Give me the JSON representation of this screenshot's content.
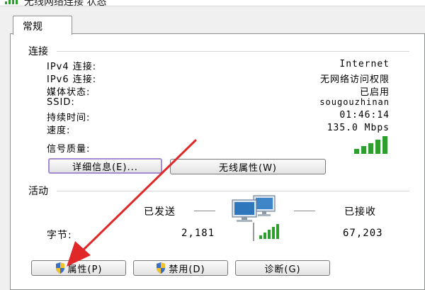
{
  "window": {
    "title": "无线网络连接 状态"
  },
  "tabs": [
    {
      "label": "常规"
    }
  ],
  "connection": {
    "section_label": "连接",
    "rows": [
      {
        "key": "IPv4 连接:",
        "value": "Internet"
      },
      {
        "key": "IPv6 连接:",
        "value": "无网络访问权限"
      },
      {
        "key": "媒体状态:",
        "value": "已启用"
      },
      {
        "key": "SSID:",
        "value": "sougouzhinan"
      },
      {
        "key": "持续时间:",
        "value": "01:46:14"
      },
      {
        "key": "速度:",
        "value": "135.0 Mbps"
      }
    ],
    "signal_label": "信号质量:",
    "signal_bars": 5,
    "buttons": {
      "details": "详细信息(E)...",
      "wireless_props": "无线属性(W)"
    }
  },
  "activity": {
    "section_label": "活动",
    "sent_label": "已发送",
    "received_label": "已接收",
    "bytes_label": "字节:",
    "bytes_sent": "2,181",
    "bytes_received": "67,203"
  },
  "bottom_buttons": {
    "properties": "属性(P)",
    "disable": "禁用(D)",
    "diagnose": "诊断(G)"
  },
  "icons": [
    "wireless-signal-icon",
    "network-computers-icon",
    "uac-shield-icon"
  ],
  "colors": {
    "signal_green": "#2e9e2e",
    "arrow_red": "#e02828",
    "focus_border": "#a48bd2"
  }
}
